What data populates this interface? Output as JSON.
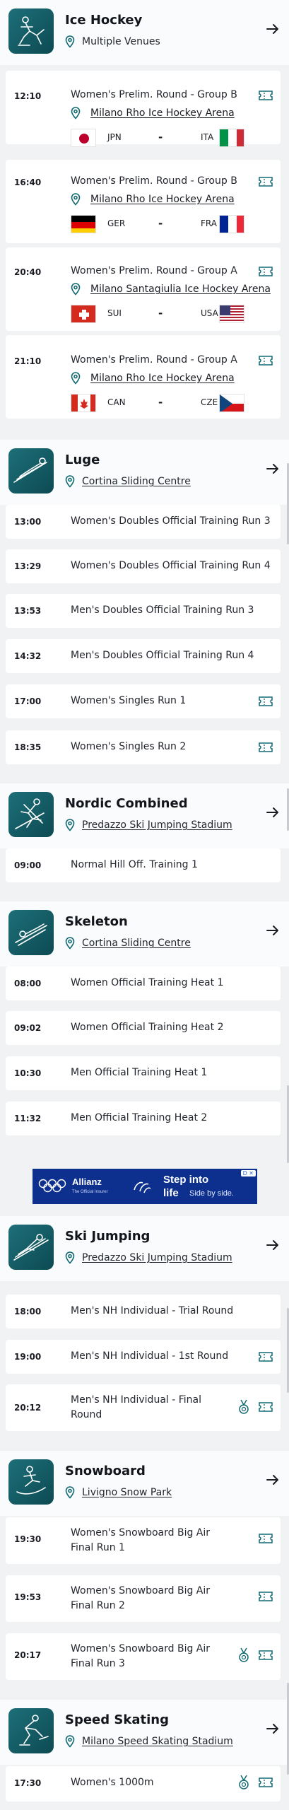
{
  "colors": {
    "accent": "#116a73",
    "card": "#ffffff",
    "background": "#f1f2f4"
  },
  "sports": [
    {
      "name": "Ice Hockey",
      "venue": "Multiple Venues",
      "icon": "ice-hockey-icon",
      "events": [
        {
          "time": "12:10",
          "name": "Women's Prelim. Round - Group B",
          "venue": "Milano Rho Ice Hockey Arena",
          "home": "JPN",
          "away": "ITA",
          "ticket": true
        },
        {
          "time": "16:40",
          "name": "Women's Prelim. Round - Group B",
          "venue": "Milano Rho Ice Hockey Arena",
          "home": "GER",
          "away": "FRA",
          "ticket": true
        },
        {
          "time": "20:40",
          "name": "Women's Prelim. Round - Group A",
          "venue": "Milano Santagiulia Ice Hockey Arena",
          "home": "SUI",
          "away": "USA",
          "ticket": true
        },
        {
          "time": "21:10",
          "name": "Women's Prelim. Round - Group A",
          "venue": "Milano Rho Ice Hockey Arena",
          "home": "CAN",
          "away": "CZE",
          "ticket": true
        }
      ]
    },
    {
      "name": "Luge",
      "venue": "Cortina Sliding Centre",
      "icon": "luge-icon",
      "events": [
        {
          "time": "13:00",
          "name": "Women's Doubles Official Training Run 3"
        },
        {
          "time": "13:29",
          "name": "Women's Doubles Official Training Run 4"
        },
        {
          "time": "13:53",
          "name": "Men's Doubles Official Training Run 3"
        },
        {
          "time": "14:32",
          "name": "Men's Doubles Official Training Run 4"
        },
        {
          "time": "17:00",
          "name": "Women's Singles Run 1",
          "ticket": true
        },
        {
          "time": "18:35",
          "name": "Women's Singles Run 2",
          "ticket": true
        }
      ]
    },
    {
      "name": "Nordic Combined",
      "venue": "Predazzo Ski Jumping Stadium",
      "icon": "nordic-combined-icon",
      "events": [
        {
          "time": "09:00",
          "name": "Normal Hill Off. Training 1"
        }
      ]
    },
    {
      "name": "Skeleton",
      "venue": "Cortina Sliding Centre",
      "icon": "skeleton-icon",
      "events": [
        {
          "time": "08:00",
          "name": "Women Official Training Heat 1"
        },
        {
          "time": "09:02",
          "name": "Women Official Training Heat 2"
        },
        {
          "time": "10:30",
          "name": "Men Official Training Heat 1"
        },
        {
          "time": "11:32",
          "name": "Men Official Training Heat 2"
        }
      ]
    },
    {
      "name": "Ski Jumping",
      "venue": "Predazzo Ski Jumping Stadium",
      "icon": "ski-jumping-icon",
      "events": [
        {
          "time": "18:00",
          "name": "Men's NH Individual - Trial Round"
        },
        {
          "time": "19:00",
          "name": "Men's NH Individual - 1st Round",
          "ticket": true
        },
        {
          "time": "20:12",
          "name": "Men's NH Individual - Final Round",
          "ticket": true,
          "medal": true
        }
      ]
    },
    {
      "name": "Snowboard",
      "venue": "Livigno Snow Park",
      "icon": "snowboard-icon",
      "events": [
        {
          "time": "19:30",
          "name": "Women's Snowboard Big Air Final Run 1",
          "ticket": true
        },
        {
          "time": "19:53",
          "name": "Women's Snowboard Big Air Final Run 2",
          "ticket": true
        },
        {
          "time": "20:17",
          "name": "Women's Snowboard Big Air Final Run 3",
          "ticket": true,
          "medal": true
        }
      ]
    },
    {
      "name": "Speed Skating",
      "venue": "Milano Speed Skating Stadium",
      "icon": "speed-skating-icon",
      "events": [
        {
          "time": "17:30",
          "name": "Women's 1000m",
          "ticket": true,
          "medal": true
        }
      ]
    }
  ],
  "ad": {
    "brand": "Allianz",
    "subtitle": "The Official Insurer",
    "cta_line1": "Step into",
    "cta_line2": "life",
    "cta_line3": "Side by side.",
    "badge": "D ✕"
  }
}
